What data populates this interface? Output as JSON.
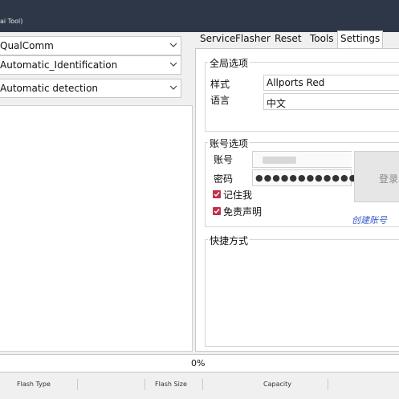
{
  "window": {
    "title": "ai Tool)"
  },
  "left": {
    "platform_combo": "QualComm",
    "mode_combo": "Automatic_Identification",
    "detect_combo": "Automatic detection"
  },
  "tabs": [
    "Service",
    "Flasher",
    "Reset",
    "Tools",
    "Settings"
  ],
  "active_tab": "Settings",
  "settings": {
    "global": {
      "title": "全局选项",
      "style_label": "样式",
      "style_value": "Allports Red",
      "language_label": "语言",
      "language_value": "中文"
    },
    "account": {
      "title": "账号选项",
      "username_label": "账号",
      "password_label": "密码",
      "password_mask": "●●●●●●●●●●●●●●●",
      "login_button": "登录",
      "remember_label": "记住我",
      "remember_checked": true,
      "disclaimer_label": "免责声明",
      "disclaimer_checked": true,
      "register_link": "创建账号"
    },
    "shortcuts": {
      "title": "快捷方式"
    }
  },
  "progress": {
    "value_percent": 0,
    "label": "0%"
  },
  "status_bar": {
    "flash_type": "Flash Type",
    "flash_size": "Flash Size",
    "capacity": "Capacity"
  },
  "colors": {
    "titlebar": "#2d3748",
    "checkbox": "#c0304a",
    "link": "#3a5dc6",
    "progress_fill": "#06b025"
  }
}
